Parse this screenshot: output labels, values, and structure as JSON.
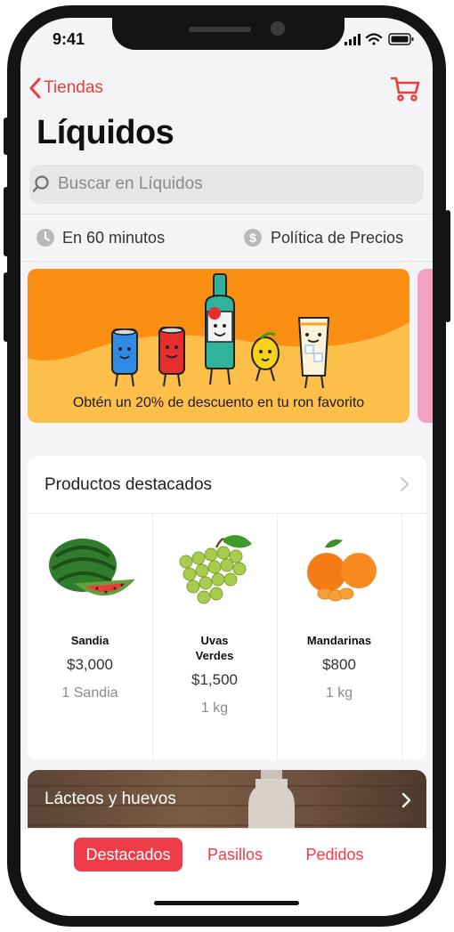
{
  "status_bar": {
    "time": "9:41"
  },
  "nav": {
    "back_label": "Tiendas",
    "title": "Líquidos"
  },
  "search": {
    "placeholder": "Buscar en Líquidos"
  },
  "info": {
    "delivery": "En 60 minutos",
    "pricing": "Política de Precios"
  },
  "banner": {
    "text": "Obtén un 20% de descuento en tu ron favorito"
  },
  "featured": {
    "title": "Productos destacados",
    "products": [
      {
        "name": "Sandia",
        "price": "$3,000",
        "unit": "1 Sandia"
      },
      {
        "name": "Uvas Verdes",
        "name_line1": "Uvas",
        "name_line2": "Verdes",
        "price": "$1,500",
        "unit": "1 kg"
      },
      {
        "name": "Mandarinas",
        "price": "$800",
        "unit": "1 kg"
      }
    ]
  },
  "category": {
    "label": "Lácteos y huevos"
  },
  "tabs": [
    {
      "label": "Destacados",
      "active": true
    },
    {
      "label": "Pasillos",
      "active": false
    },
    {
      "label": "Pedidos",
      "active": false
    }
  ],
  "colors": {
    "accent": "#ee3c48",
    "banner_bg": "#fdbf4a"
  }
}
